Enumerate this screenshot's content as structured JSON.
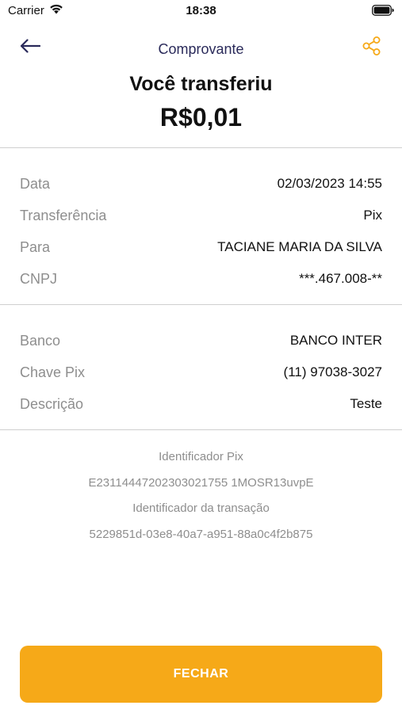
{
  "status_bar": {
    "carrier": "Carrier",
    "time": "18:38",
    "wifi_icon": "wifi-icon",
    "battery_icon": "battery-icon"
  },
  "header": {
    "title": "Comprovante",
    "back_icon": "arrow-left-icon",
    "share_icon": "share-icon",
    "accent_color": "#f6a918",
    "title_color": "#2a2a5a"
  },
  "summary": {
    "headline": "Você transferiu",
    "amount": "R$0,01"
  },
  "details": [
    {
      "label": "Data",
      "value": "02/03/2023 14:55"
    },
    {
      "label": "Transferência",
      "value": "Pix"
    },
    {
      "label": "Para",
      "value": "TACIANE MARIA DA SILVA"
    },
    {
      "label": "CNPJ",
      "value": "***.467.008-**"
    }
  ],
  "bank_details": [
    {
      "label": "Banco",
      "value": "BANCO INTER"
    },
    {
      "label": "Chave Pix",
      "value": "(11) 97038-3027"
    },
    {
      "label": "Descrição",
      "value": "Teste"
    }
  ],
  "identifiers": {
    "pix_label": "Identificador Pix",
    "pix_value": "E23114447202303021755 1MOSR13uvpE",
    "transaction_label": "Identificador da transação",
    "transaction_value": "5229851d-03e8-40a7-a951-88a0c4f2b875"
  },
  "actions": {
    "close_label": "FECHAR"
  }
}
